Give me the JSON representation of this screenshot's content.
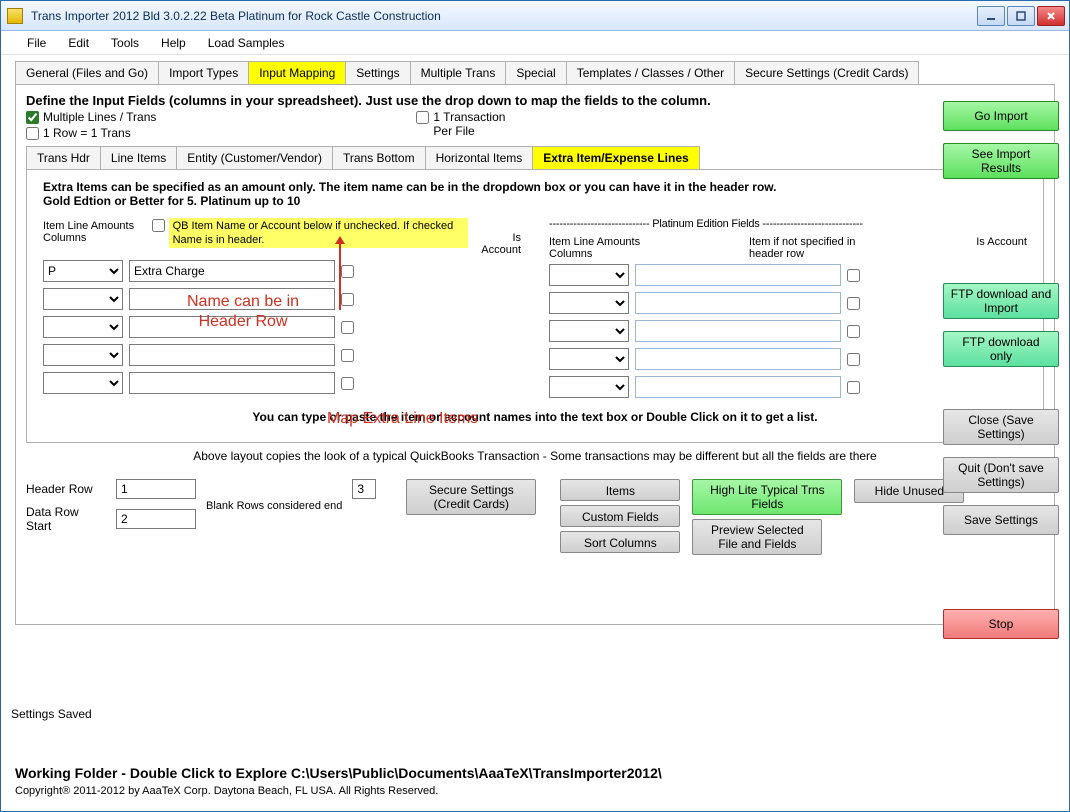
{
  "titlebar": "Trans Importer 2012 Bld 3.0.2.22 Beta Platinum  for Rock Castle Construction",
  "menu": {
    "file": "File",
    "edit": "Edit",
    "tools": "Tools",
    "help": "Help",
    "load": "Load Samples"
  },
  "tabs": [
    "General (Files and Go)",
    "Import Types",
    "Input Mapping",
    "Settings",
    "Multiple Trans",
    "Special",
    "Templates / Classes / Other",
    "Secure Settings (Credit Cards)"
  ],
  "active_tab": 2,
  "heading": "Define the Input Fields (columns in your spreadsheet). Just use the drop down to map the fields to the column.",
  "chk": {
    "multi": "Multiple Lines / Trans",
    "row1": "1 Row = 1 Trans",
    "oneper": "1 Transaction\nPer File"
  },
  "subtabs": [
    "Trans Hdr",
    "Line Items",
    "Entity (Customer/Vendor)",
    "Trans Bottom",
    "Horizontal Items",
    "Extra Item/Expense Lines"
  ],
  "active_subtab": 5,
  "intro": "Extra Items can be specified as an amount only.  The item name can be in the dropdown box or you can have it in the header row.\nGold Edtion or Better for 5.  Platinum up to 10",
  "left": {
    "label1": "Item Line Amounts Columns",
    "yellow": "QB Item Name or Account below if unchecked. If checked Name is in header.",
    "isacc": "Is Account",
    "rows": [
      {
        "col": "P",
        "name": "Extra Charge"
      },
      {
        "col": "",
        "name": ""
      },
      {
        "col": "",
        "name": ""
      },
      {
        "col": "",
        "name": ""
      },
      {
        "col": "",
        "name": ""
      }
    ]
  },
  "right": {
    "head": "----------------------------- Platinum Edition Fields -----------------------------",
    "label1": "Item Line Amounts Columns",
    "label2": "Item if not specified in header row",
    "isacc": "Is Account",
    "rows": [
      {
        "col": "",
        "name": ""
      },
      {
        "col": "",
        "name": ""
      },
      {
        "col": "",
        "name": ""
      },
      {
        "col": "",
        "name": ""
      },
      {
        "col": "",
        "name": ""
      }
    ]
  },
  "footer_note": "You can type or paste the item or account names into the text box or Double Click on it to get a list.",
  "below_note": "Above layout copies the look of a typical QuickBooks Transaction - Some transactions may be different but all the fields are there",
  "red": {
    "name": "Name can be in\nHeader Row",
    "map": "Map Extra Line Items"
  },
  "bottom": {
    "hr_label": "Header Row",
    "hr_value": "1",
    "dr_label": "Data Row Start",
    "dr_value": "2",
    "blank_label": "Blank Rows considered end",
    "blank_value": "3",
    "secure": "Secure Settings (Credit Cards)",
    "items": "Items",
    "custom": "Custom Fields",
    "sort": "Sort Columns",
    "highlite": "High Lite Typical Trns Fields",
    "preview": "Preview Selected File and Fields",
    "hide": "Hide Unused"
  },
  "right_buttons": {
    "go": "Go Import",
    "see": "See Import Results",
    "ftp1": "FTP download and Import",
    "ftp2": "FTP download only",
    "close": "Close (Save Settings)",
    "quit": "Quit (Don't save Settings)",
    "save": "Save Settings",
    "stop": "Stop"
  },
  "status": "Settings Saved",
  "working": "Working Folder - Double Click to Explore C:\\Users\\Public\\Documents\\AaaTeX\\TransImporter2012\\",
  "copyright": "Copyright® 2011-2012 by AaaTeX Corp. Daytona Beach, FL USA. All Rights Reserved."
}
